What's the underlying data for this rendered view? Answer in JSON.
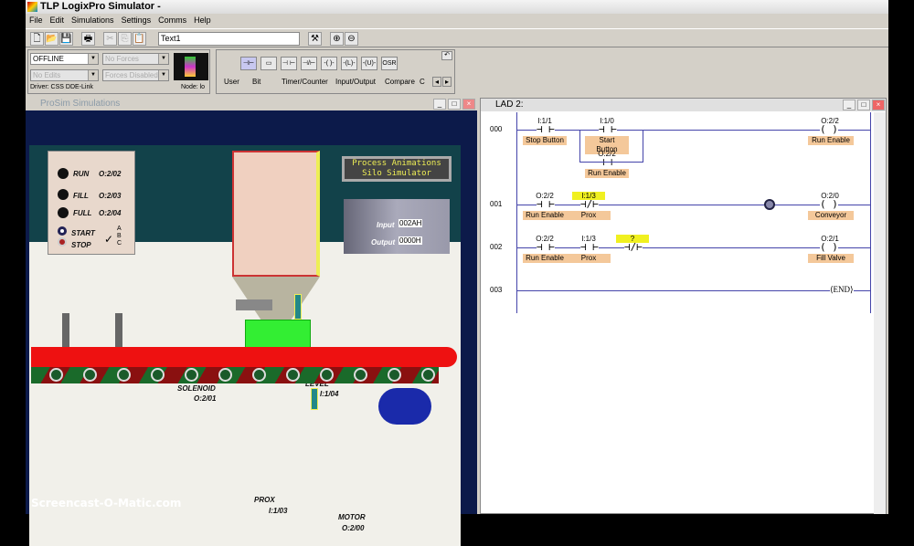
{
  "app": {
    "title": "TLP LogixPro Simulator  -",
    "menu": [
      "File",
      "Edit",
      "Simulations",
      "Settings",
      "Comms",
      "Help"
    ],
    "text_field": "Text1"
  },
  "status": {
    "mode": "OFFLINE",
    "forces": "No Forces",
    "edits": "No Edits",
    "forces_state": "Forces Disabled",
    "driver": "Driver: CSS DDE-Link",
    "node": "Node: lo"
  },
  "instructions": {
    "buttons": [
      "⊣⊢",
      "▭",
      "⊣ ⊢",
      "⊣/⊢",
      "-( )-",
      "-(L)-",
      "-(U)-",
      "OSR"
    ],
    "tabs": [
      "User",
      "Bit",
      "Timer/Counter",
      "Input/Output",
      "Compare",
      "C"
    ]
  },
  "prosim": {
    "title": "ProSim Simulations",
    "banner": [
      "Process Animations",
      "Silo Simulator"
    ],
    "panel": [
      {
        "label": "RUN",
        "addr": "O:2/02"
      },
      {
        "label": "FILL",
        "addr": "O:2/03"
      },
      {
        "label": "FULL",
        "addr": "O:2/04"
      }
    ],
    "start": "START",
    "stop": "STOP",
    "abc": [
      "A",
      "B",
      "C"
    ],
    "plc_input_label": "Input",
    "plc_input": "002AH",
    "plc_output_label": "Output",
    "plc_output": "0000H",
    "solenoid": {
      "label": "SOLENOID",
      "addr": "O:2/01"
    },
    "level": {
      "label": "LEVEL",
      "addr": "I:1/04"
    },
    "prox": {
      "label": "PROX",
      "addr": "I:1/03"
    },
    "motor": {
      "label": "MOTOR",
      "addr": "O:2/00"
    },
    "watermark": "Screencast-O-Matic.com"
  },
  "lad": {
    "title": "LAD 2:",
    "rungs": [
      {
        "num": "000",
        "elements": [
          {
            "addr": "I:1/1",
            "tag": "Stop Button",
            "type": "XIC"
          },
          {
            "addr": "I:1/0",
            "tag": "Start Button",
            "type": "XIC"
          },
          {
            "addr": "O:2/2",
            "tag": "Run Enable",
            "type": "XIC"
          }
        ],
        "output": {
          "addr": "O:2/2",
          "tag": "Run Enable"
        }
      },
      {
        "num": "001",
        "elements": [
          {
            "addr": "O:2/2",
            "tag": "Run Enable",
            "type": "XIC"
          },
          {
            "addr": "I:1/3",
            "tag": "Prox",
            "type": "XIO"
          }
        ],
        "output": {
          "addr": "O:2/0",
          "tag": "Conveyor"
        }
      },
      {
        "num": "002",
        "elements": [
          {
            "addr": "O:2/2",
            "tag": "Run Enable",
            "type": "XIC"
          },
          {
            "addr": "I:1/3",
            "tag": "Prox",
            "type": "XIC"
          },
          {
            "addr": "?",
            "tag": "",
            "type": "XIO"
          }
        ],
        "output": {
          "addr": "O:2/1",
          "tag": "Fill Valve"
        }
      },
      {
        "num": "003",
        "end": "END"
      }
    ]
  }
}
